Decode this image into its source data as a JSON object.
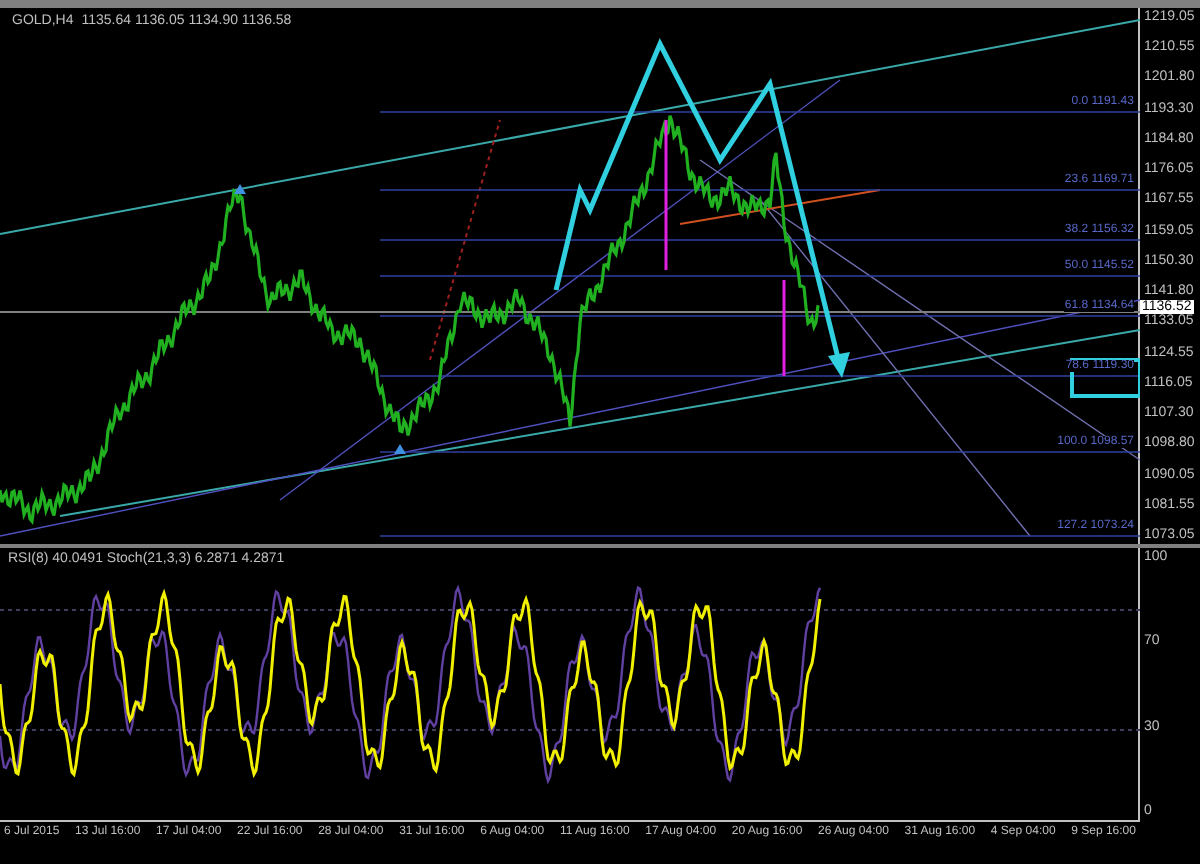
{
  "chart_header": {
    "symbol": "GOLD,H4",
    "quotes": "1135.64 1136.05 1134.90 1136.58"
  },
  "price_axis": [
    "1219.05",
    "1210.55",
    "1201.80",
    "1193.30",
    "1184.80",
    "1176.05",
    "1167.55",
    "1159.05",
    "1150.30",
    "1141.80",
    "1133.05",
    "1124.55",
    "1116.05",
    "1107.30",
    "1098.80",
    "1090.05",
    "1081.55",
    "1073.05"
  ],
  "current_price": "1136.52",
  "fib_levels": [
    "0.0 1191.43",
    "23.6 1169.71",
    "38.2 1156.32",
    "50.0 1145.52",
    "61.8 1134.64",
    "78.6 1119.30",
    "100.0 1098.57",
    "127.2 1073.24"
  ],
  "indicator_header": "RSI(8) 40.0491 Stoch(21,3,3) 6.2871 4.2871",
  "indicator_axis": [
    "100",
    "70",
    "30",
    "0"
  ],
  "time_axis": [
    "6 Jul 2015",
    "13 Jul 16:00",
    "17 Jul 04:00",
    "22 Jul 16:00",
    "28 Jul 04:00",
    "31 Jul 16:00",
    "6 Aug 04:00",
    "11 Aug 16:00",
    "17 Aug 04:00",
    "20 Aug 16:00",
    "26 Aug 04:00",
    "31 Aug 16:00",
    "4 Sep 04:00",
    "9 Sep 16:00"
  ]
}
